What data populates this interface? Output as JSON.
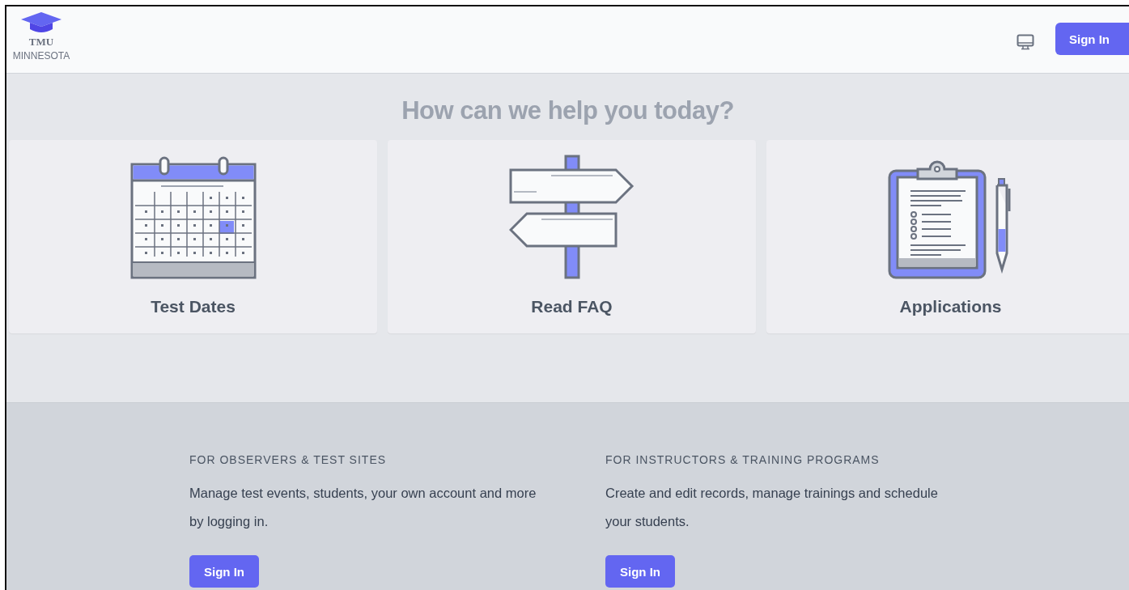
{
  "header": {
    "logo": {
      "line_1": "TMU",
      "line_2": "MINNESOTA"
    },
    "sign_in": "Sign In"
  },
  "help": {
    "title": "How can we help you today?",
    "cards": [
      {
        "kind": "calendar",
        "label": "Test Dates"
      },
      {
        "kind": "signpost",
        "label": "Read FAQ"
      },
      {
        "kind": "clipboard",
        "label": "Applications"
      }
    ]
  },
  "portals": [
    {
      "heading": "FOR OBSERVERS & TEST SITES",
      "text": "Manage test events, students, your own account and more by logging in.",
      "button": "Sign In"
    },
    {
      "heading": "FOR INSTRUCTORS & TRAINING PROGRAMS",
      "text": "Create and edit records, manage trainings and schedule your students.",
      "button": "Sign In"
    }
  ]
}
